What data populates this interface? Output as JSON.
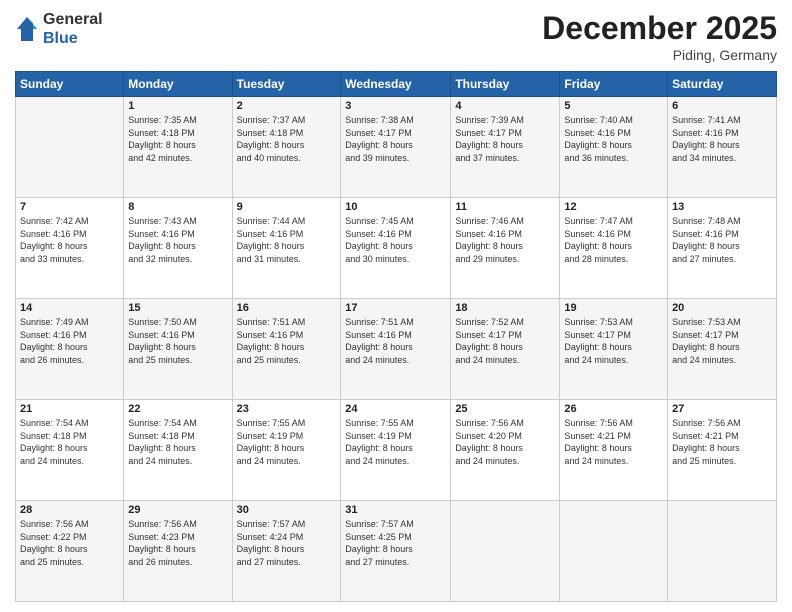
{
  "header": {
    "logo_general": "General",
    "logo_blue": "Blue",
    "month": "December 2025",
    "location": "Piding, Germany"
  },
  "weekdays": [
    "Sunday",
    "Monday",
    "Tuesday",
    "Wednesday",
    "Thursday",
    "Friday",
    "Saturday"
  ],
  "weeks": [
    [
      {
        "day": "",
        "info": ""
      },
      {
        "day": "1",
        "info": "Sunrise: 7:35 AM\nSunset: 4:18 PM\nDaylight: 8 hours\nand 42 minutes."
      },
      {
        "day": "2",
        "info": "Sunrise: 7:37 AM\nSunset: 4:18 PM\nDaylight: 8 hours\nand 40 minutes."
      },
      {
        "day": "3",
        "info": "Sunrise: 7:38 AM\nSunset: 4:17 PM\nDaylight: 8 hours\nand 39 minutes."
      },
      {
        "day": "4",
        "info": "Sunrise: 7:39 AM\nSunset: 4:17 PM\nDaylight: 8 hours\nand 37 minutes."
      },
      {
        "day": "5",
        "info": "Sunrise: 7:40 AM\nSunset: 4:16 PM\nDaylight: 8 hours\nand 36 minutes."
      },
      {
        "day": "6",
        "info": "Sunrise: 7:41 AM\nSunset: 4:16 PM\nDaylight: 8 hours\nand 34 minutes."
      }
    ],
    [
      {
        "day": "7",
        "info": "Sunrise: 7:42 AM\nSunset: 4:16 PM\nDaylight: 8 hours\nand 33 minutes."
      },
      {
        "day": "8",
        "info": "Sunrise: 7:43 AM\nSunset: 4:16 PM\nDaylight: 8 hours\nand 32 minutes."
      },
      {
        "day": "9",
        "info": "Sunrise: 7:44 AM\nSunset: 4:16 PM\nDaylight: 8 hours\nand 31 minutes."
      },
      {
        "day": "10",
        "info": "Sunrise: 7:45 AM\nSunset: 4:16 PM\nDaylight: 8 hours\nand 30 minutes."
      },
      {
        "day": "11",
        "info": "Sunrise: 7:46 AM\nSunset: 4:16 PM\nDaylight: 8 hours\nand 29 minutes."
      },
      {
        "day": "12",
        "info": "Sunrise: 7:47 AM\nSunset: 4:16 PM\nDaylight: 8 hours\nand 28 minutes."
      },
      {
        "day": "13",
        "info": "Sunrise: 7:48 AM\nSunset: 4:16 PM\nDaylight: 8 hours\nand 27 minutes."
      }
    ],
    [
      {
        "day": "14",
        "info": "Sunrise: 7:49 AM\nSunset: 4:16 PM\nDaylight: 8 hours\nand 26 minutes."
      },
      {
        "day": "15",
        "info": "Sunrise: 7:50 AM\nSunset: 4:16 PM\nDaylight: 8 hours\nand 25 minutes."
      },
      {
        "day": "16",
        "info": "Sunrise: 7:51 AM\nSunset: 4:16 PM\nDaylight: 8 hours\nand 25 minutes."
      },
      {
        "day": "17",
        "info": "Sunrise: 7:51 AM\nSunset: 4:16 PM\nDaylight: 8 hours\nand 24 minutes."
      },
      {
        "day": "18",
        "info": "Sunrise: 7:52 AM\nSunset: 4:17 PM\nDaylight: 8 hours\nand 24 minutes."
      },
      {
        "day": "19",
        "info": "Sunrise: 7:53 AM\nSunset: 4:17 PM\nDaylight: 8 hours\nand 24 minutes."
      },
      {
        "day": "20",
        "info": "Sunrise: 7:53 AM\nSunset: 4:17 PM\nDaylight: 8 hours\nand 24 minutes."
      }
    ],
    [
      {
        "day": "21",
        "info": "Sunrise: 7:54 AM\nSunset: 4:18 PM\nDaylight: 8 hours\nand 24 minutes."
      },
      {
        "day": "22",
        "info": "Sunrise: 7:54 AM\nSunset: 4:18 PM\nDaylight: 8 hours\nand 24 minutes."
      },
      {
        "day": "23",
        "info": "Sunrise: 7:55 AM\nSunset: 4:19 PM\nDaylight: 8 hours\nand 24 minutes."
      },
      {
        "day": "24",
        "info": "Sunrise: 7:55 AM\nSunset: 4:19 PM\nDaylight: 8 hours\nand 24 minutes."
      },
      {
        "day": "25",
        "info": "Sunrise: 7:56 AM\nSunset: 4:20 PM\nDaylight: 8 hours\nand 24 minutes."
      },
      {
        "day": "26",
        "info": "Sunrise: 7:56 AM\nSunset: 4:21 PM\nDaylight: 8 hours\nand 24 minutes."
      },
      {
        "day": "27",
        "info": "Sunrise: 7:56 AM\nSunset: 4:21 PM\nDaylight: 8 hours\nand 25 minutes."
      }
    ],
    [
      {
        "day": "28",
        "info": "Sunrise: 7:56 AM\nSunset: 4:22 PM\nDaylight: 8 hours\nand 25 minutes."
      },
      {
        "day": "29",
        "info": "Sunrise: 7:56 AM\nSunset: 4:23 PM\nDaylight: 8 hours\nand 26 minutes."
      },
      {
        "day": "30",
        "info": "Sunrise: 7:57 AM\nSunset: 4:24 PM\nDaylight: 8 hours\nand 27 minutes."
      },
      {
        "day": "31",
        "info": "Sunrise: 7:57 AM\nSunset: 4:25 PM\nDaylight: 8 hours\nand 27 minutes."
      },
      {
        "day": "",
        "info": ""
      },
      {
        "day": "",
        "info": ""
      },
      {
        "day": "",
        "info": ""
      }
    ]
  ]
}
